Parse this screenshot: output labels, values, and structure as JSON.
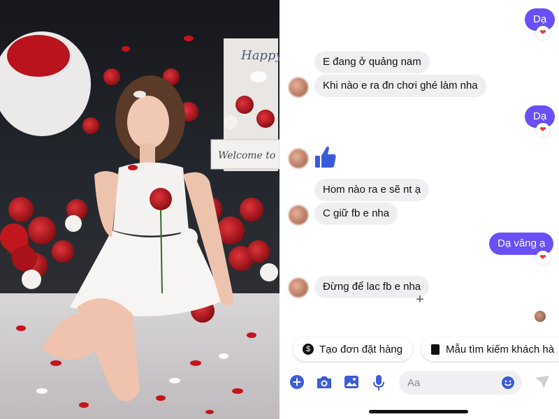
{
  "messages": {
    "out_1": "Dạ",
    "in_1": "E đang ở quảng nam",
    "in_2": "Khi nào e ra đn chơi ghé làm nha",
    "out_2": "Dạ",
    "in_3": "Hom nào ra e sẽ nt ạ",
    "in_4": "C giữ fb e nha",
    "out_3": "Dạ vâng ạ",
    "in_5": "Đừng để lac fb e nha"
  },
  "reaction": "❤",
  "quick_replies": {
    "create_order": "Tạo đơn đặt hàng",
    "search_template": "Mẫu tìm kiếm khách hà"
  },
  "composer": {
    "placeholder": "Aa"
  },
  "photo_sign": {
    "happy": "Happy",
    "welcome": "Welcome to"
  },
  "colors": {
    "accent": "#6b4ff6",
    "icon_blue": "#3b5bdb",
    "incoming_bg": "#efeff2"
  }
}
